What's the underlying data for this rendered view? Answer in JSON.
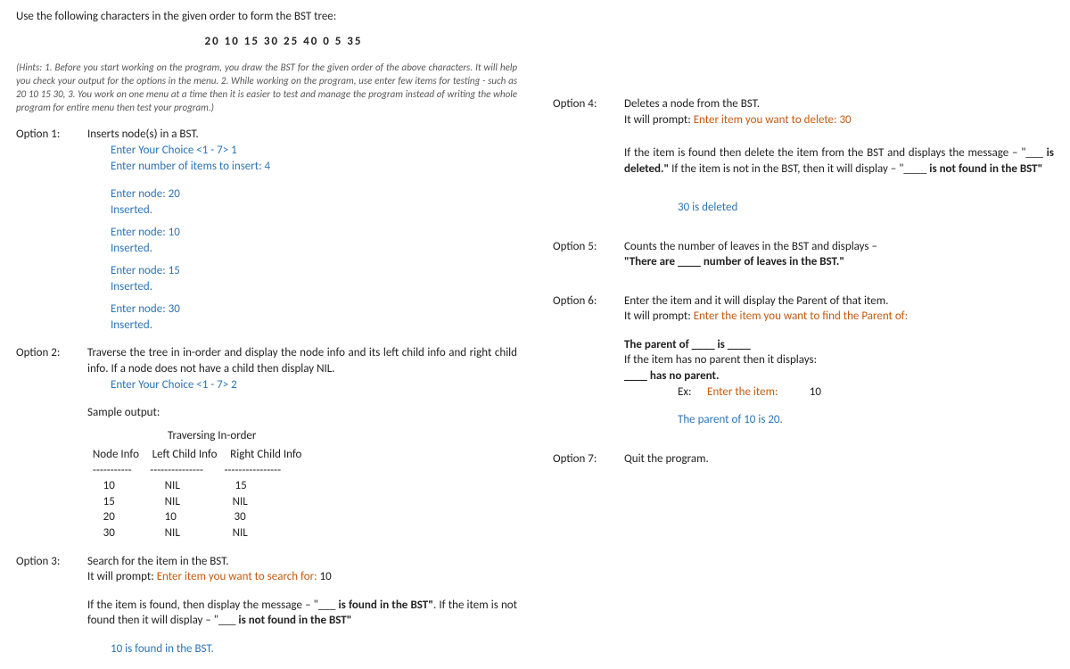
{
  "left": {
    "heading": "Use the following characters in the given order to form the BST tree:",
    "sequence": "20   10   15   30   25   40   0   5  35",
    "hints": "(Hints: 1. Before you start working on the program, you draw the BST for the given order of the above characters. It will help you check your output for the options in the menu. 2. While working on the program, use enter few items for testing - such as 20 10 15 30, 3. You work on one menu at a time then it is easier to test and manage the program instead of writing the whole program for entire menu then test your program.)",
    "opt1": {
      "label": "Option 1:",
      "title": "Inserts node(s) in a BST.",
      "choice": "Enter Your Choice <1 - 7> 1",
      "num": "Enter number of items to insert:  4",
      "lines": [
        "Enter node: 20",
        "Inserted.",
        "",
        "Enter node: 10",
        "Inserted.",
        "",
        "Enter node: 15",
        "Inserted.",
        "",
        "Enter node: 30",
        "Inserted."
      ]
    },
    "opt2": {
      "label": "Option 2:",
      "desc": "Traverse the tree in in-order and display the node info and its left child info and right child info. If a node does not have a child then display NIL.",
      "choice": "Enter Your Choice <1 - 7> 2",
      "sample": "Sample output:",
      "tableTitle": "Traversing In-order",
      "table": "  Node Info     Left Child Info     Right Child Info\n  -----------       ---------------        ----------------\n      10                   NIL                     15\n      15                   NIL                    NIL\n      20                   10                      30\n      30                   NIL                    NIL"
    },
    "opt3": {
      "label": "Option 3:",
      "title": "Search for the item in the BST.",
      "promptLead": "It will prompt: ",
      "prompt": "Enter item you want to search for:",
      "promptVal": "     10",
      "msg1a": "If the item is found, then display the message – \"",
      "msg1b": " is found in the BST\"",
      "msg1c": ". If the item is not found then it will display – \"",
      "msg1d": " is not found in the BST\"",
      "result": "10 is found in the BST."
    }
  },
  "right": {
    "opt4": {
      "label": "Option 4:",
      "title": "Deletes a node from the BST.",
      "promptLead": "It will prompt: ",
      "prompt": "Enter item you want to delete: 30",
      "msg_a": "If the item is found then delete the item from the BST and displays the message – \"",
      "msg_b": " is deleted.\"",
      "msg_c": " If the item is not in the BST, then it will display – \"",
      "msg_d": " is not found in the BST\"",
      "result": "30 is deleted"
    },
    "opt5": {
      "label": "Option 5:",
      "line1": "Counts the number of leaves in the BST and displays –",
      "line2": "\"There are ____ number of leaves in the BST.\""
    },
    "opt6": {
      "label": "Option 6:",
      "line1": "Enter the item and it will display the Parent of that item.",
      "promptLead": "It will prompt:  ",
      "prompt": "Enter the item you want to find the Parent of:",
      "bold1": "The parent of ____ is ____",
      "plain": "If the item has no parent then it displays:",
      "bold2": "____ has no parent.",
      "exLabel": "Ex:",
      "exPrompt": "Enter the item:",
      "exVal": "10",
      "exResult": "The parent of 10 is 20."
    },
    "opt7": {
      "label": "Option 7:",
      "text": "Quit the program."
    }
  }
}
